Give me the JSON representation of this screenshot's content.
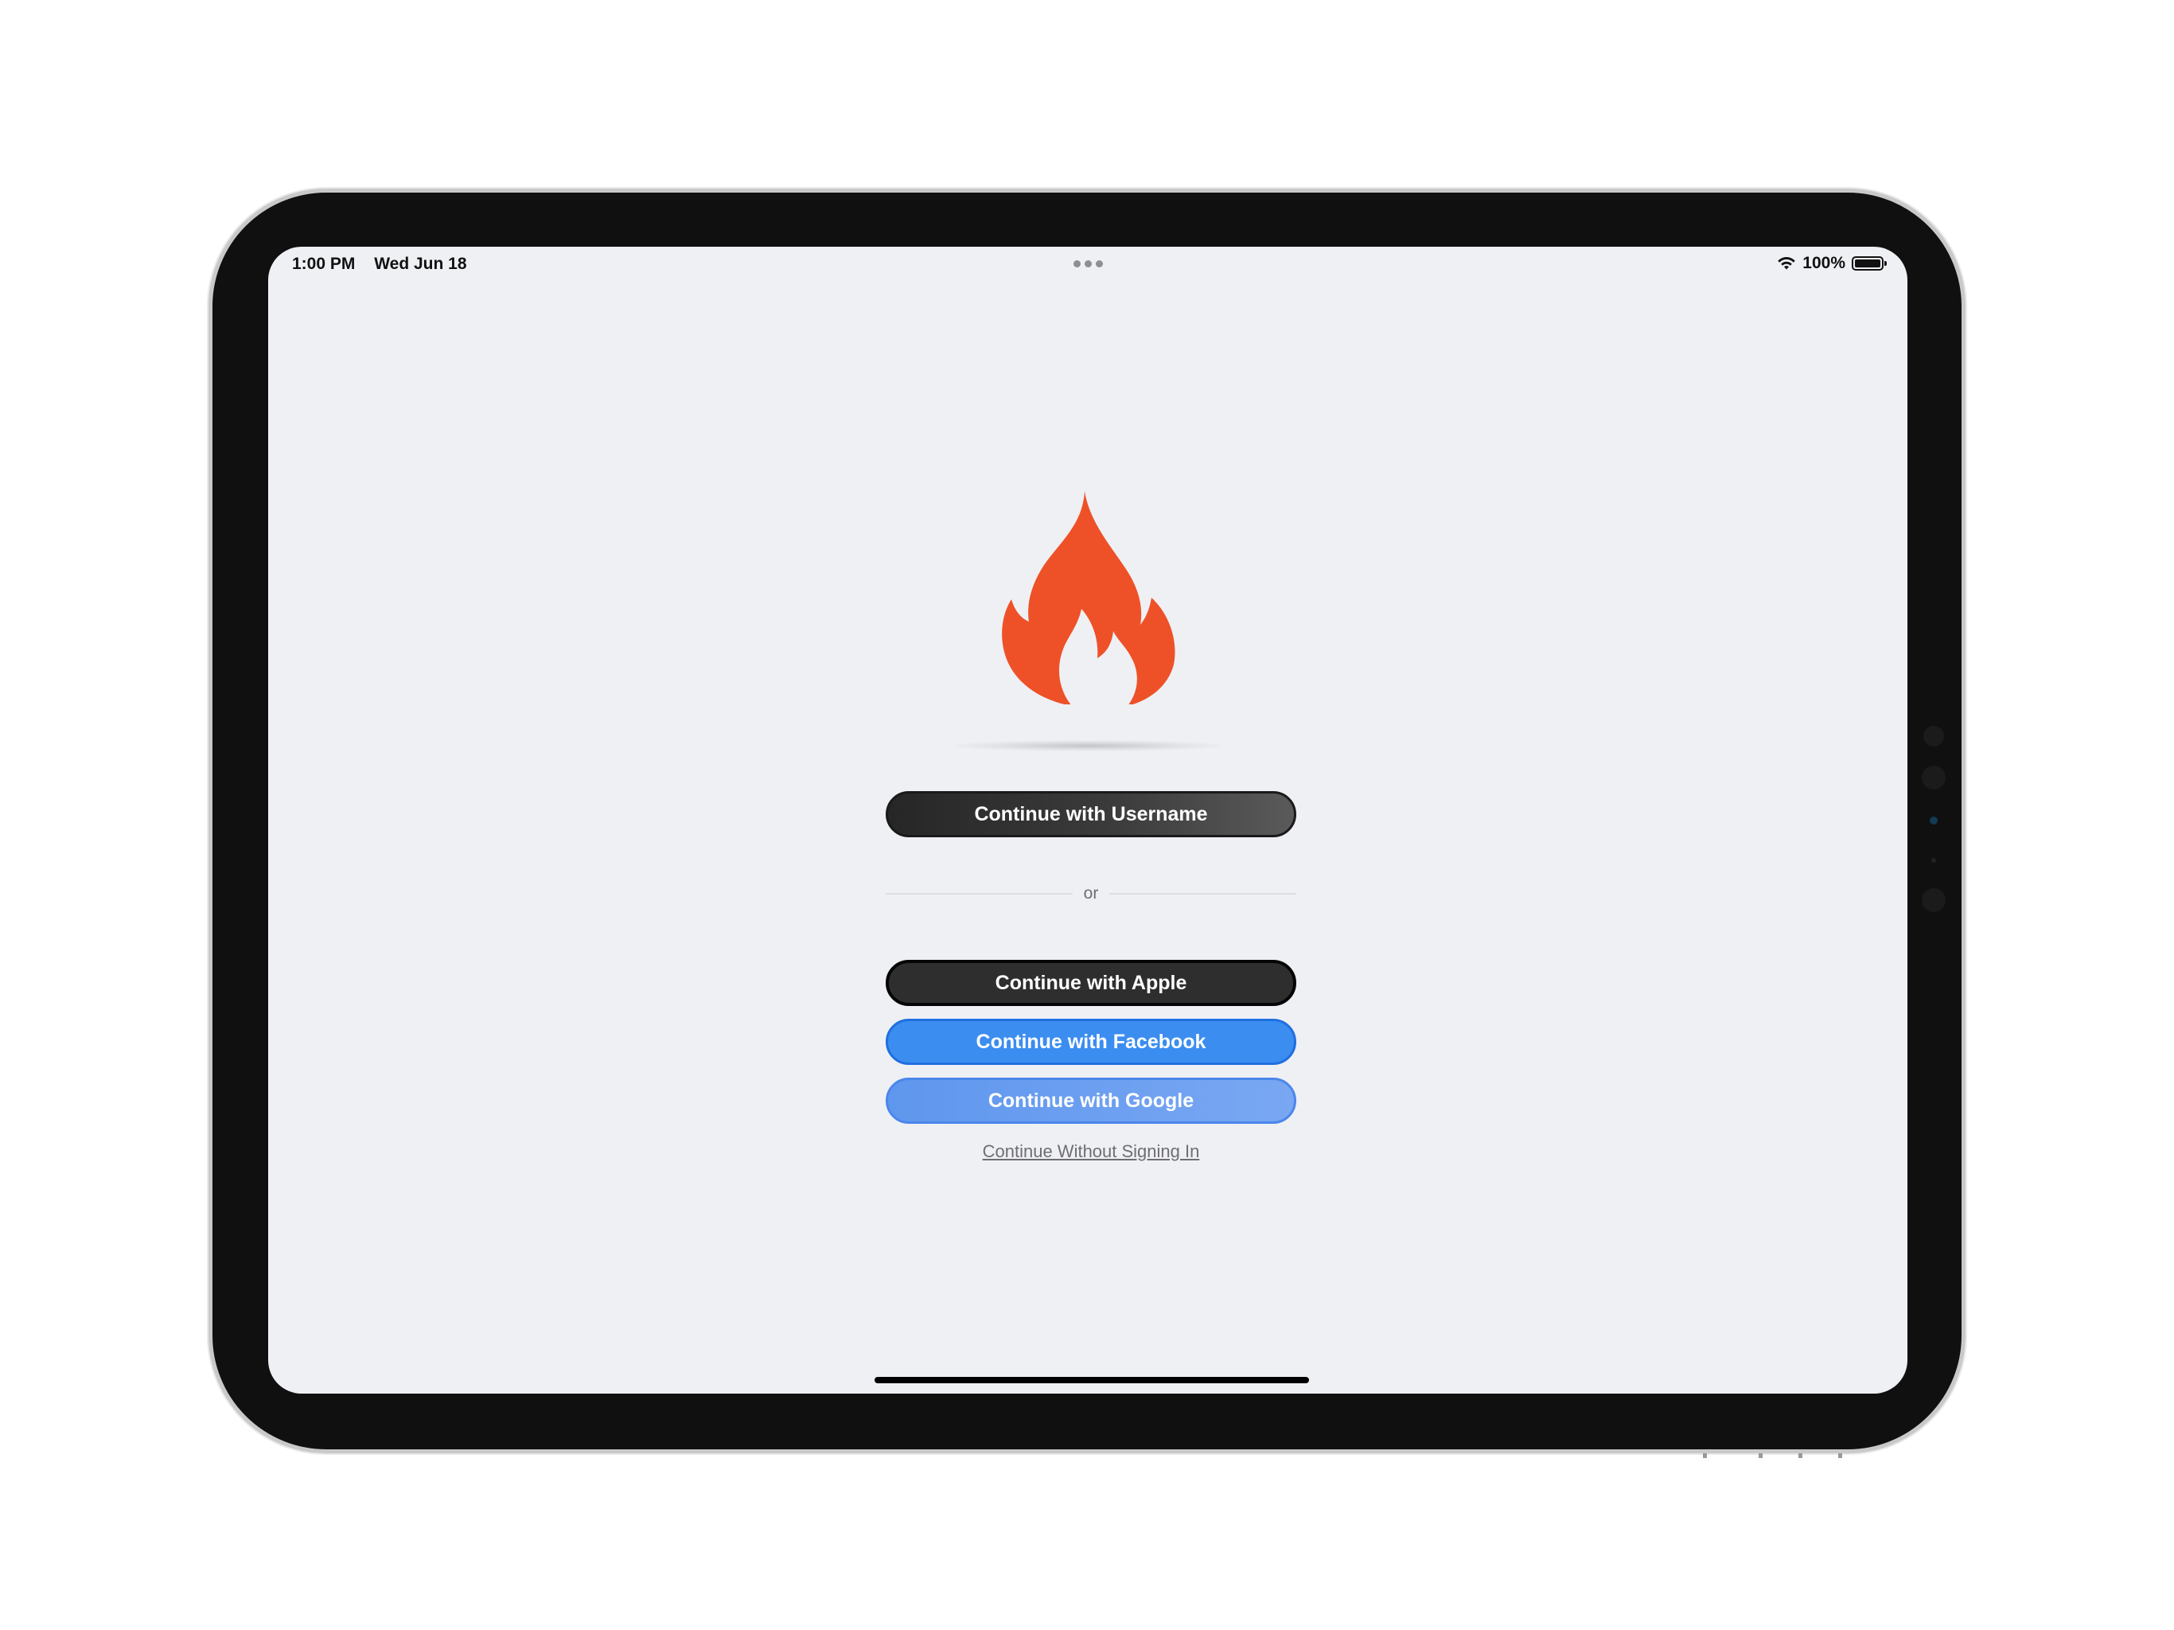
{
  "status_bar": {
    "time": "1:00 PM",
    "date": "Wed Jun 18",
    "battery_percent": "100%",
    "wifi_icon": "wifi-icon",
    "battery_icon": "battery-icon"
  },
  "logo": {
    "icon": "flame-icon",
    "color": "#ee5128"
  },
  "buttons": {
    "username": "Continue with Username",
    "apple": "Continue with Apple",
    "facebook": "Continue with Facebook",
    "google": "Continue with Google"
  },
  "divider": {
    "text": "or"
  },
  "skip_link": "Continue Without Signing In",
  "colors": {
    "facebook_blue": "#3b8df0",
    "google_blue": "#6c9ff1",
    "dark_button": "#2e2e2e",
    "background": "#eff0f4"
  }
}
